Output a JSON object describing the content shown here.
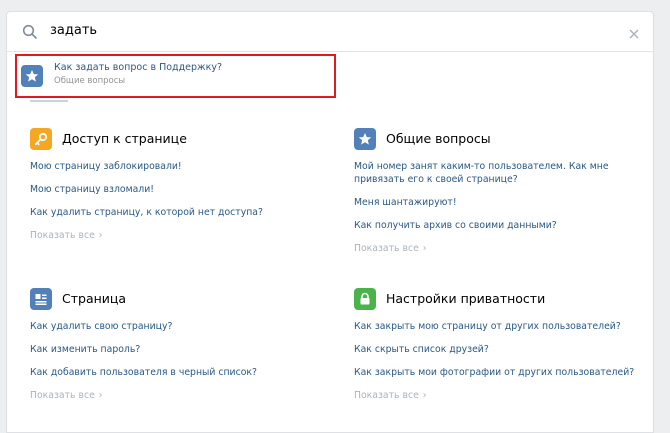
{
  "search": {
    "query": "задать",
    "search_icon": "search-icon",
    "clear_icon": "close-icon"
  },
  "result": {
    "icon": "star-icon",
    "title": "Как задать вопрос в Поддержку?",
    "category": "Общие вопросы"
  },
  "sections": [
    {
      "title": "Доступ к странице",
      "icon": "key-icon",
      "color": "#f5a623",
      "links": [
        "Мою страницу заблокировали!",
        "Мою страницу взломали!",
        "Как удалить страницу, к которой нет доступа?"
      ],
      "show_all": "Показать все"
    },
    {
      "title": "Общие вопросы",
      "icon": "star-icon",
      "color": "#5181b8",
      "links": [
        "Мой номер занят каким-то пользователем. Как мне привязать его к своей странице?",
        "Меня шантажируют!",
        "Как получить архив со своими данными?"
      ],
      "show_all": "Показать все"
    },
    {
      "title": "Страница",
      "icon": "profile-icon",
      "color": "#5181b8",
      "links": [
        "Как удалить свою страницу?",
        "Как изменить пароль?",
        "Как добавить пользователя в черный список?"
      ],
      "show_all": "Показать все"
    },
    {
      "title": "Настройки приватности",
      "icon": "lock-icon",
      "color": "#4bb34b",
      "links": [
        "Как закрыть мою страницу от других пользователей?",
        "Как скрыть список друзей?",
        "Как закрыть мои фотографии от других пользователей?"
      ],
      "show_all": "Показать все"
    }
  ]
}
